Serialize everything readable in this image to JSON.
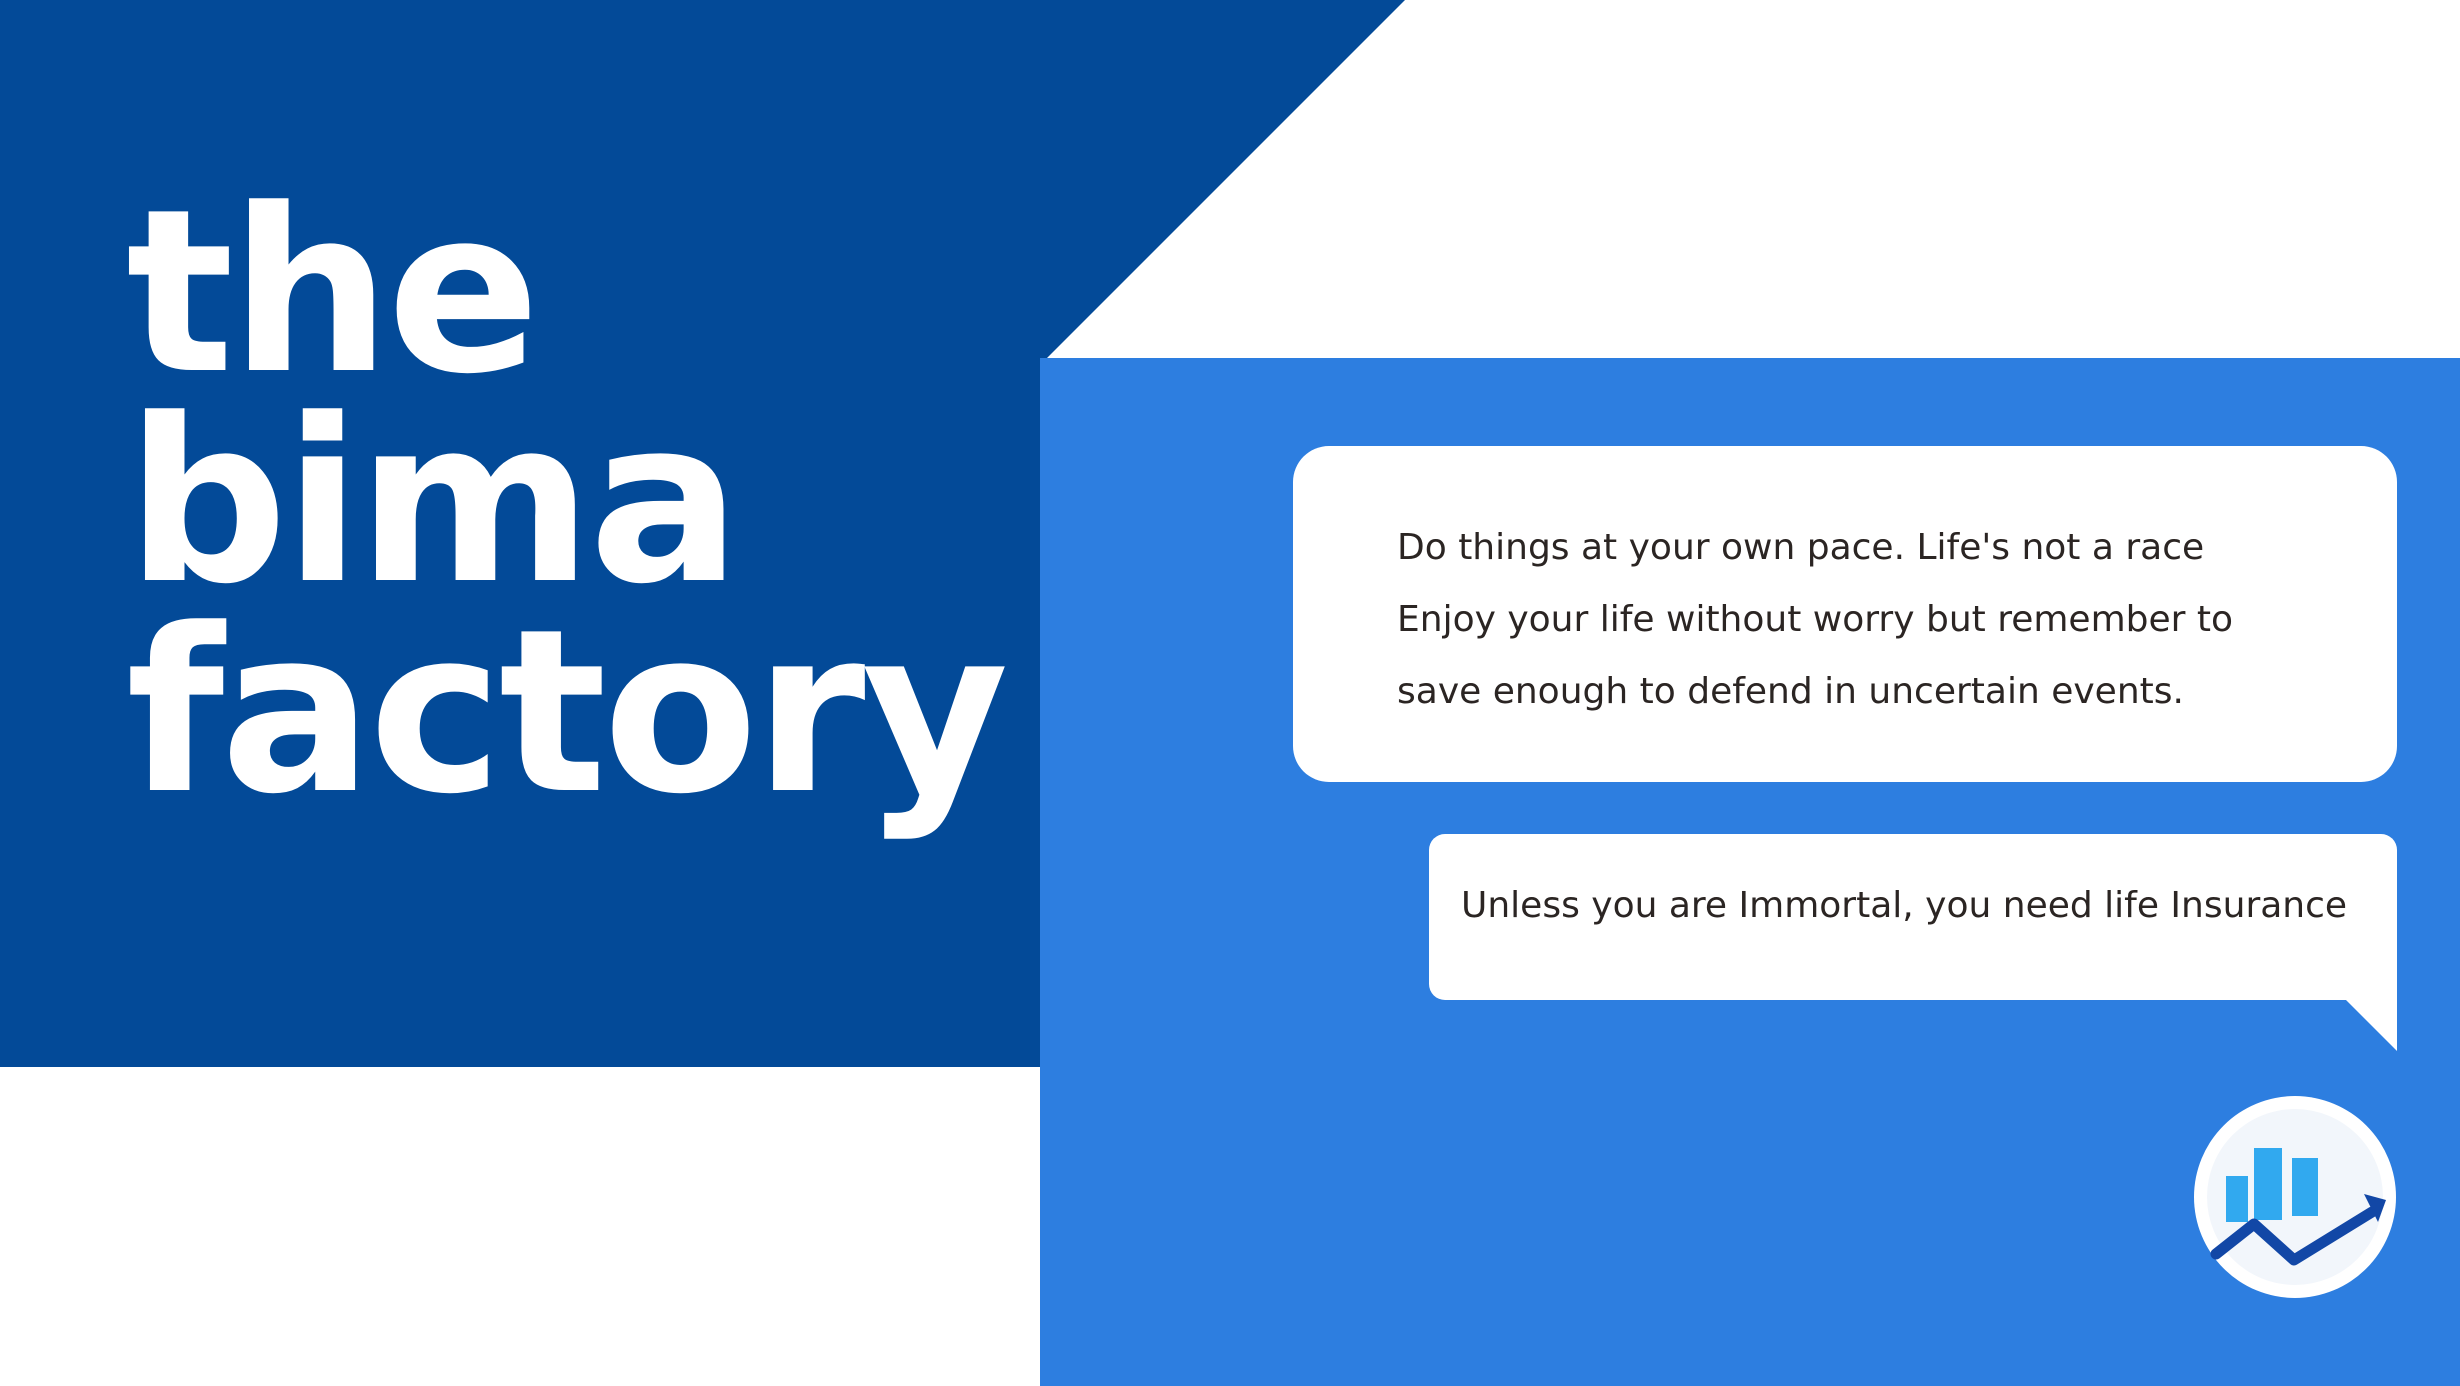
{
  "brand": {
    "title_lines": [
      "the",
      "bima",
      "factory"
    ]
  },
  "messages": [
    {
      "lines": [
        "Do things at your own pace. Life's not a race",
        "Enjoy your life without worry but remember to",
        "save enough to defend in uncertain events."
      ]
    },
    {
      "text": "Unless you are Immortal, you need life Insurance"
    }
  ],
  "logo": {
    "icon": "bar-chart-growth-arrow-icon"
  },
  "colors": {
    "dark_blue": "#034a98",
    "bright_blue": "#2d7ee0",
    "bubble": "#ffffff",
    "text": "#2b2523",
    "logo_bars": "#31a9ef",
    "logo_arrow": "#1247a6"
  }
}
